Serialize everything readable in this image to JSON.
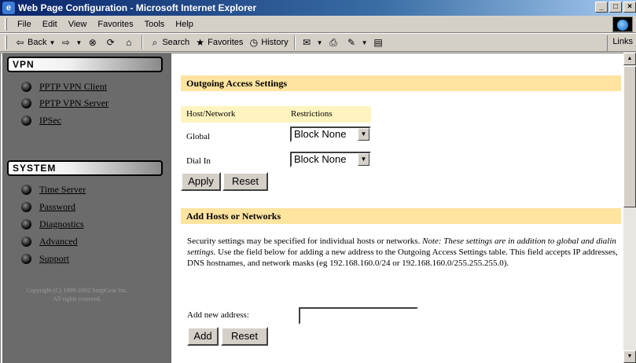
{
  "window": {
    "title": "Web Page Configuration - Microsoft Internet Explorer",
    "icon": "ie-icon",
    "controls": [
      "minimize-icon",
      "maximize-icon",
      "close-icon"
    ]
  },
  "menu": [
    "File",
    "Edit",
    "View",
    "Favorites",
    "Tools",
    "Help"
  ],
  "toolbar": {
    "back": "Back",
    "search": "Search",
    "favorites": "Favorites",
    "history": "History",
    "links": "Links"
  },
  "nav": {
    "vpn_header": "VPN",
    "vpn_items": [
      "PPTP VPN Client",
      "PPTP VPN Server",
      "IPSec"
    ],
    "system_header": "SYSTEM",
    "system_items": [
      "Time Server",
      "Password",
      "Diagnostics",
      "Advanced",
      "Support"
    ],
    "copyright_line1": "Copyright (C) 1999-2002 SnapGear Inc.",
    "copyright_line2": "All rights reserved."
  },
  "outgoing": {
    "title": "Outgoing Access Settings",
    "col_host": "Host/Network",
    "col_restrictions": "Restrictions",
    "rows": [
      {
        "label": "Global",
        "value": "Block None"
      },
      {
        "label": "Dial In",
        "value": "Block None"
      }
    ],
    "apply_label": "Apply",
    "reset_label": "Reset"
  },
  "add_hosts": {
    "title": "Add Hosts or Networks",
    "para_part1": "Security settings may be specified for individual hosts or networks. ",
    "para_note": "Note: These settings are in addition to global and dialin settings.",
    "para_part2": " Use the field below for adding a new address to the Outgoing Access Settings table. This field accepts IP addresses, DNS hostnames, and network masks (eg 192.168.160.0/24 or 192.168.160.0/255.255.255.0).",
    "input_label": "Add new address:",
    "input_value": "",
    "add_label": "Add",
    "reset_label": "Reset"
  }
}
